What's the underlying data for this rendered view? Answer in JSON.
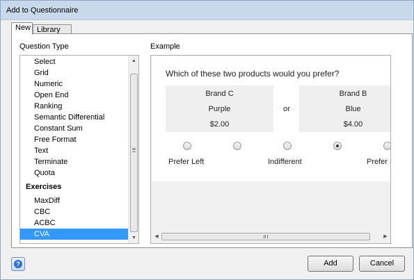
{
  "window": {
    "title": "Add to Questionnaire"
  },
  "tabs": [
    {
      "label": "New"
    },
    {
      "label": "Library"
    }
  ],
  "question_type": {
    "label": "Question Type",
    "items": [
      "Select",
      "Grid",
      "Numeric",
      "Open End",
      "Ranking",
      "Semantic Differential",
      "Constant Sum",
      "Free Format",
      "Text",
      "Terminate",
      "Quota"
    ],
    "exercises_header": "Exercises",
    "exercises": [
      "MaxDiff",
      "CBC",
      "ACBC",
      "CVA"
    ],
    "selected": "CVA"
  },
  "example": {
    "label": "Example",
    "question": "Which of these two products would you prefer?",
    "left_product": [
      "Brand C",
      "Purple",
      "$2.00"
    ],
    "right_product": [
      "Brand B",
      "Blue",
      "$4.00"
    ],
    "or_text": "or",
    "scale_labels": {
      "left": "Prefer Left",
      "middle": "Indifferent",
      "right": "Prefer Right"
    },
    "selected_point": 4
  },
  "buttons": {
    "add": "Add",
    "cancel": "Cancel",
    "help": "?"
  },
  "icons": [
    "help-icon",
    "scroll-up-icon",
    "scroll-down-icon",
    "scroll-left-icon",
    "scroll-right-icon"
  ]
}
